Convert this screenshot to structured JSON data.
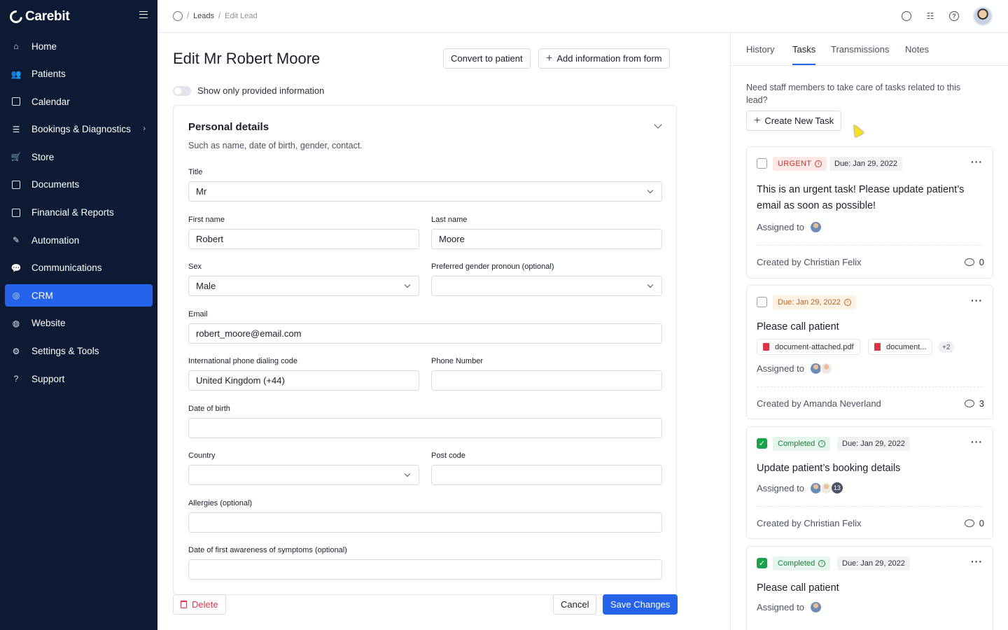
{
  "app": {
    "brand": "Carebit"
  },
  "sidebar": {
    "items": [
      {
        "label": "Home",
        "icon": "home-icon"
      },
      {
        "label": "Patients",
        "icon": "users-icon"
      },
      {
        "label": "Calendar",
        "icon": "calendar-icon"
      },
      {
        "label": "Bookings & Diagnostics",
        "icon": "list-icon",
        "has_submenu": true
      },
      {
        "label": "Store",
        "icon": "cart-icon"
      },
      {
        "label": "Documents",
        "icon": "documents-icon"
      },
      {
        "label": "Financial & Reports",
        "icon": "report-icon"
      },
      {
        "label": "Automation",
        "icon": "wand-icon"
      },
      {
        "label": "Communications",
        "icon": "chat-icon"
      },
      {
        "label": "CRM",
        "icon": "crm-icon",
        "active": true
      },
      {
        "label": "Website",
        "icon": "globe-icon"
      },
      {
        "label": "Settings & Tools",
        "icon": "gear-icon"
      },
      {
        "label": "Support",
        "icon": "help-icon"
      }
    ]
  },
  "breadcrumb": {
    "leads": "Leads",
    "current": "Edit Lead",
    "separator": "/"
  },
  "header": {
    "title": "Edit Mr Robert Moore",
    "convert_label": "Convert to patient",
    "add_info_label": "Add information from form",
    "toggle_label": "Show only provided information"
  },
  "personal_details": {
    "title": "Personal details",
    "subtitle": "Such as name, date of birth, gender, contact.",
    "fields": {
      "title": {
        "label": "Title",
        "value": "Mr"
      },
      "first_name": {
        "label": "First name",
        "value": "Robert"
      },
      "last_name": {
        "label": "Last name",
        "value": "Moore"
      },
      "sex": {
        "label": "Sex",
        "value": "Male"
      },
      "pronoun": {
        "label": "Preferred gender pronoun (optional)",
        "value": ""
      },
      "email": {
        "label": "Email",
        "value": "robert_moore@email.com"
      },
      "dialing_code": {
        "label": "International phone dialing code",
        "value": "United Kingdom (+44)"
      },
      "phone": {
        "label": "Phone Number",
        "value": ""
      },
      "dob": {
        "label": "Date of birth",
        "value": ""
      },
      "country": {
        "label": "Country",
        "value": ""
      },
      "post_code": {
        "label": "Post code",
        "value": ""
      },
      "allergies": {
        "label": "Allergies (optional)",
        "value": ""
      },
      "symptoms_date": {
        "label": "Date of first awareness of symptoms (optional)",
        "value": ""
      }
    }
  },
  "footer": {
    "delete_label": "Delete",
    "cancel_label": "Cancel",
    "save_label": "Save Changes"
  },
  "panel": {
    "tabs": [
      "History",
      "Tasks",
      "Transmissions",
      "Notes"
    ],
    "active_tab": "Tasks",
    "intro": "Need staff members to take care of tasks related to this lead?",
    "create_label": "Create New Task",
    "assigned_label": "Assigned to",
    "tasks": [
      {
        "status": "URGENT",
        "due": "Due: Jan 29, 2022",
        "title": "This is an urgent task! Please update patient’s email as soon as possible!",
        "created_by": "Created by Christian Felix",
        "comments": "0"
      },
      {
        "due": "Due: Jan 29, 2022",
        "title": "Please call patient",
        "attachments": [
          "document-attached.pdf",
          "document..."
        ],
        "more_attachments": "+2",
        "created_by": "Created by Amanda Neverland",
        "comments": "3"
      },
      {
        "status": "Completed",
        "due": "Due: Jan 29, 2022",
        "title": "Update patient’s booking details",
        "assignee_count": "13",
        "created_by": "Created by Christian Felix",
        "comments": "0"
      },
      {
        "status": "Completed",
        "due": "Due: Jan 29, 2022",
        "title": "Please call patient"
      }
    ]
  },
  "colors": {
    "sidebar_bg": "#0d1a33",
    "accent": "#2563eb",
    "urgent": "#c0392b",
    "completed": "#16a34a"
  }
}
